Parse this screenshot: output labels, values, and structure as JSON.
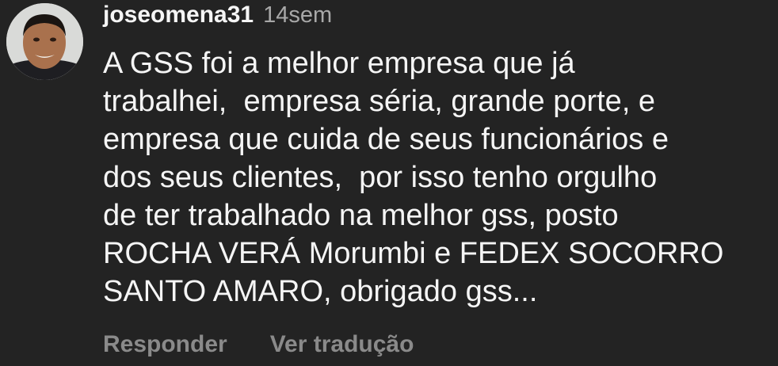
{
  "comment": {
    "avatar_icon": "user-avatar-photo",
    "username": "joseomena31",
    "timestamp": "14sem",
    "text_lines": [
      "A GSS foi a melhor empresa que já",
      "trabalhei,  empresa séria, grande porte, e",
      "empresa que cuida de seus funcionários e",
      "dos seus clientes,  por isso tenho orgulho",
      "de ter trabalhado na melhor gss, posto",
      "ROCHA VERÁ Morumbi e FEDEX SOCORRO",
      "SANTO AMARO, obrigado gss..."
    ],
    "actions": {
      "reply_label": "Responder",
      "translate_label": "Ver tradução"
    }
  },
  "colors": {
    "background": "#232323",
    "text_primary": "#f5f5f5",
    "text_secondary": "#a8a8a8",
    "action_text": "#8a8a8a"
  }
}
